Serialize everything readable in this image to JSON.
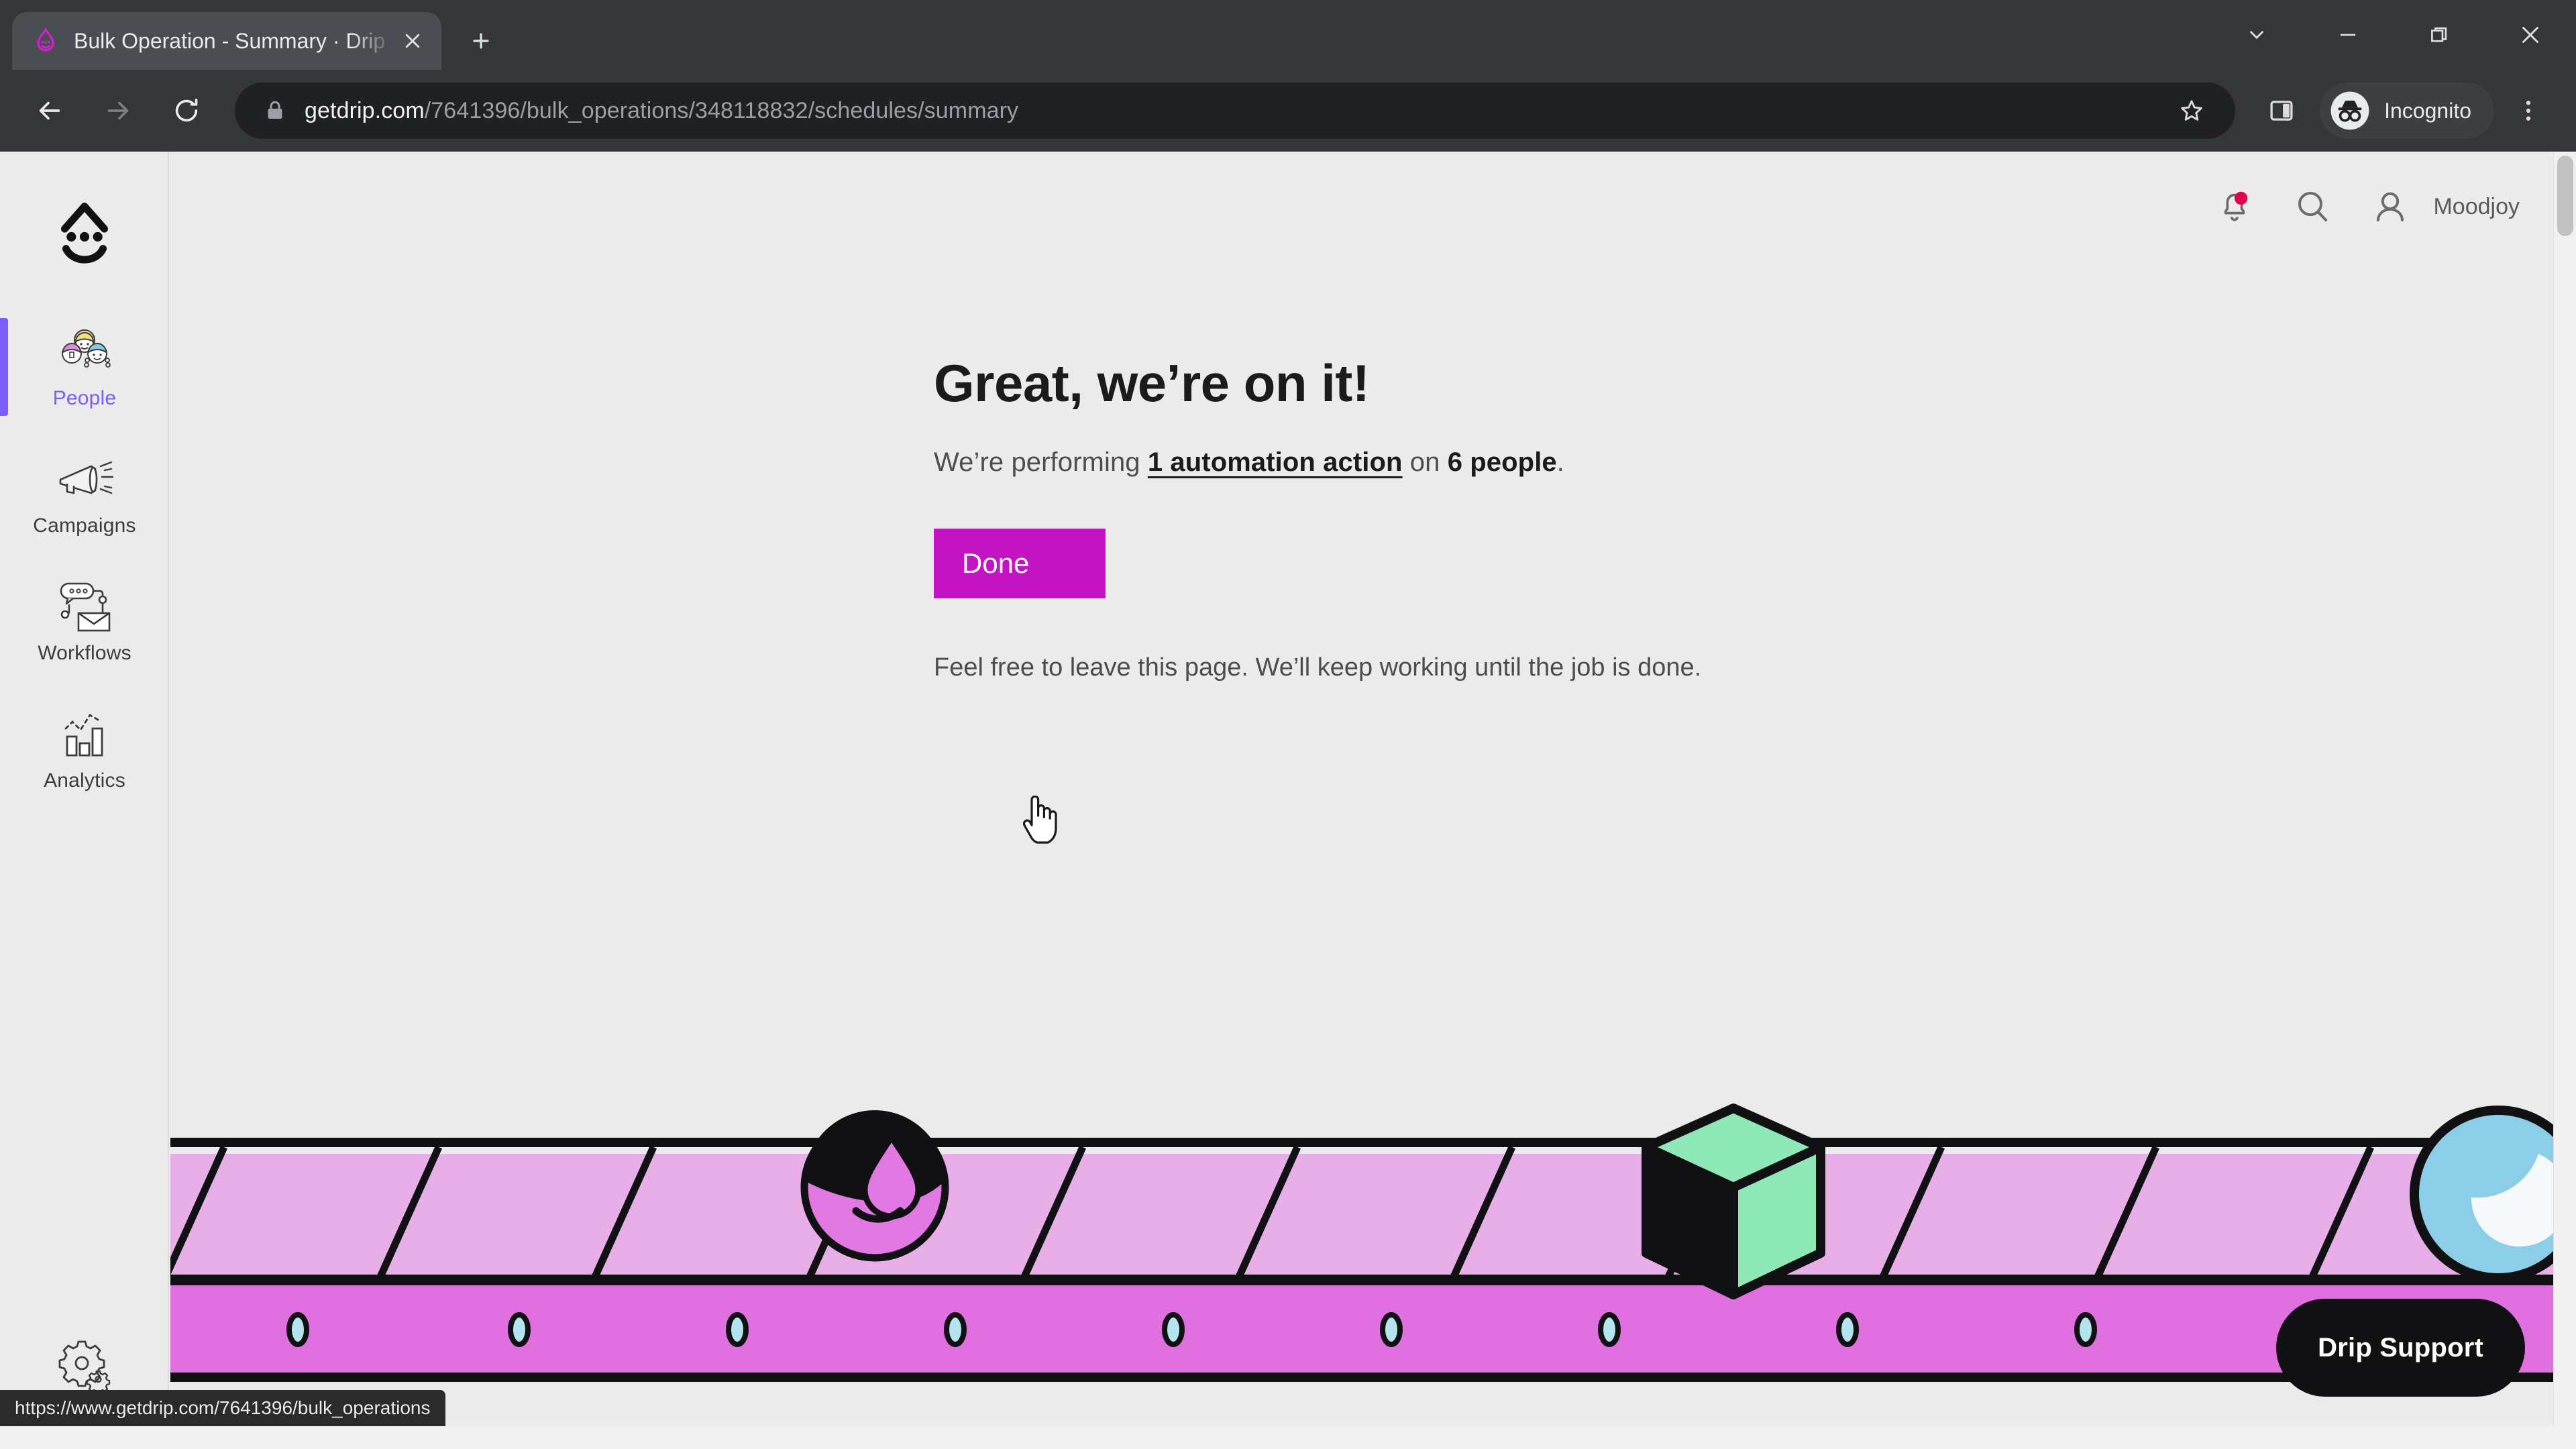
{
  "browser": {
    "tab": {
      "title": "Bulk Operation - Summary · Drip",
      "favicon_name": "drip-logo-favicon"
    },
    "new_tab_label": "+",
    "window_controls": {
      "tab_search": "tab-search",
      "minimize": "minimize",
      "restore": "restore",
      "close": "close"
    },
    "nav": {
      "back": "back",
      "forward": "forward",
      "reload": "reload"
    },
    "omnibox": {
      "lock": "site-information-lock",
      "url_domain": "getdrip.com",
      "url_path": "/7641396/bulk_operations/348118832/schedules/summary",
      "bookmark": "bookmark-star"
    },
    "toolbar_right": {
      "side_panel": "side-panel",
      "profile_label": "Incognito",
      "menu": "three-dot-menu"
    },
    "status_bubble": "https://www.getdrip.com/7641396/bulk_operations"
  },
  "app": {
    "logo_name": "drip-smiley-logo",
    "sidebar": {
      "items": [
        {
          "label": "People",
          "icon": "people-icon",
          "active": true
        },
        {
          "label": "Campaigns",
          "icon": "megaphone-icon",
          "active": false
        },
        {
          "label": "Workflows",
          "icon": "workflow-icon",
          "active": false
        },
        {
          "label": "Analytics",
          "icon": "bar-chart-icon",
          "active": false
        }
      ],
      "settings": {
        "label": "Settings",
        "icon": "gear-icon"
      }
    },
    "header": {
      "notifications_icon": "bell-icon",
      "has_notification": true,
      "search_icon": "search-icon",
      "account_icon": "person-icon",
      "account_name": "Moodjoy"
    },
    "main": {
      "heading": "Great, we’re on it!",
      "subtitle_prefix": "We’re performing ",
      "subtitle_link": "1 automation action",
      "subtitle_middle": " on ",
      "subtitle_count": "6 people",
      "subtitle_suffix": ".",
      "done_button": "Done",
      "note": "Feel free to leave this page. We’ll keep working until the job is done."
    },
    "support_button": "Drip Support",
    "colors": {
      "accent_magenta": "#C414C4",
      "active_purple": "#7C5CFA",
      "notification_red": "#E4004A",
      "belt_light": "#E8AEE8",
      "belt_dark": "#E070E0",
      "cube_green": "#8FE8B8",
      "ball_blue": "#8CCDE8",
      "page_bg": "#EBEBEB"
    },
    "illustration": {
      "name": "conveyor-belt-illustration",
      "items": [
        "drip-face-character",
        "green-cube",
        "blue-ball"
      ],
      "roller_count": 10
    }
  }
}
